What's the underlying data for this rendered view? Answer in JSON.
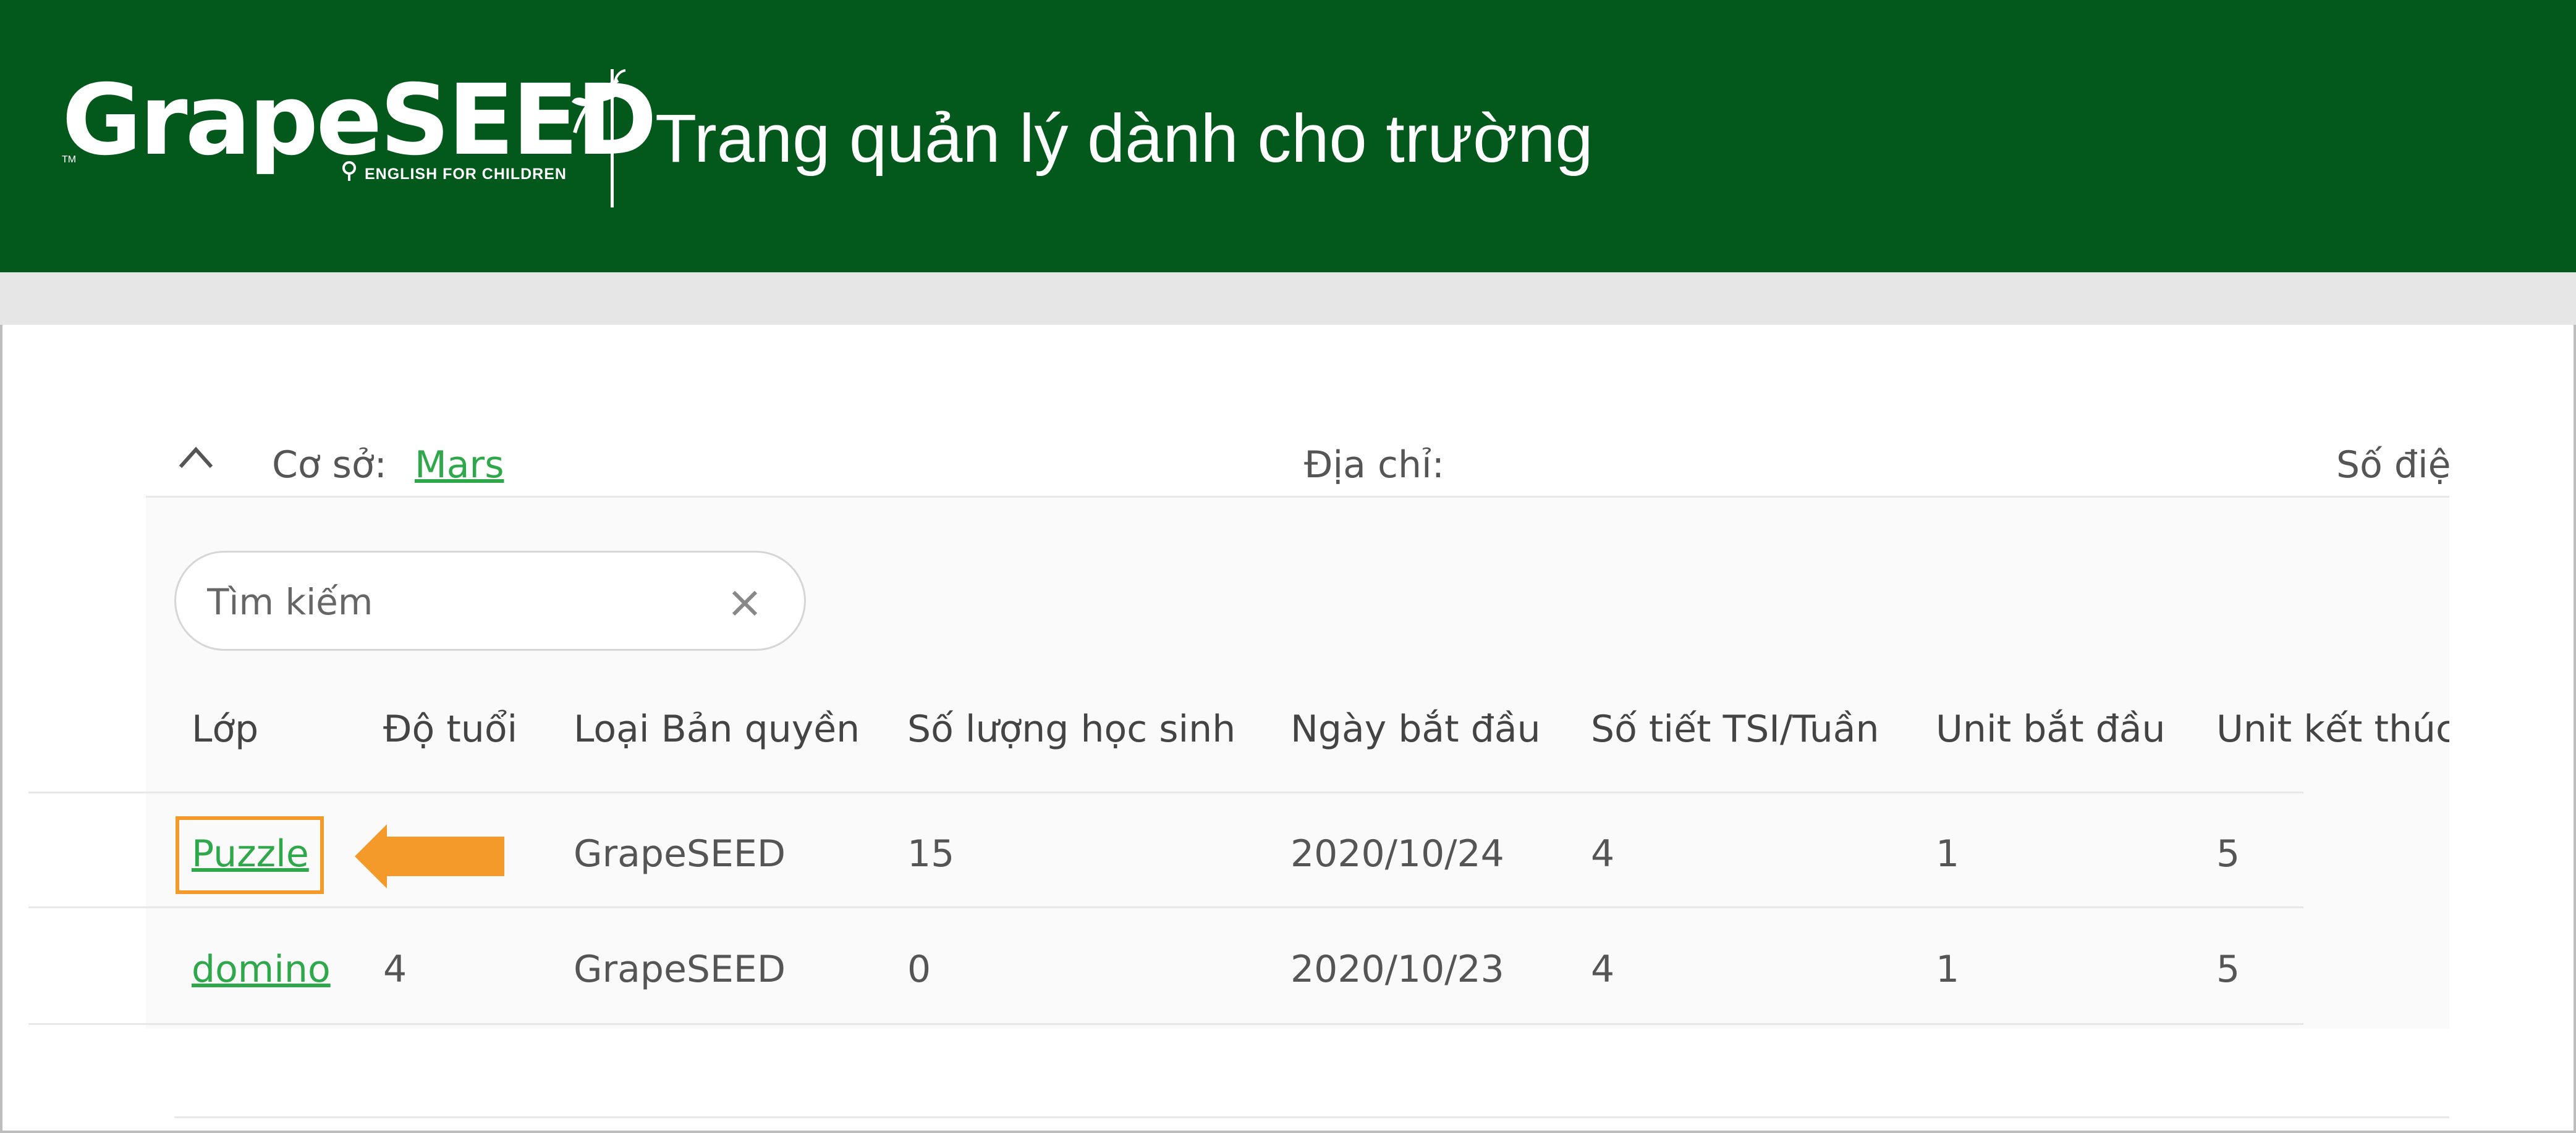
{
  "header": {
    "logo_text": "GrapeSEED",
    "logo_subtitle": "ENGLISH FOR CHILDREN",
    "logo_tm": "TM",
    "title": "Trang quản lý dành cho trường"
  },
  "campus": {
    "label": "Cơ sở:",
    "name": "Mars",
    "address_label": "Địa chỉ:",
    "phone_label": "Số điệ"
  },
  "search": {
    "placeholder": "Tìm kiếm"
  },
  "table": {
    "columns": [
      "Lớp",
      "Độ tuổi",
      "Loại Bản quyền",
      "Số lượng học sinh",
      "Ngày bắt đầu",
      "Số tiết TSI/Tuần",
      "Unit bắt đầu",
      "Unit kết thúc"
    ],
    "rows": [
      [
        "Puzzle",
        "",
        "GrapeSEED",
        "15",
        "2020/10/24",
        "4",
        "1",
        "5"
      ],
      [
        "domino",
        "4",
        "GrapeSEED",
        "0",
        "2020/10/23",
        "4",
        "1",
        "5"
      ]
    ]
  },
  "colors": {
    "brand_green": "#03591c",
    "link_green": "#2ea84a",
    "highlight_orange": "#f39a2b"
  },
  "icons": {
    "collapse": "chevron-up-icon",
    "clear": "close-icon",
    "annotation": "arrow-left-icon"
  }
}
